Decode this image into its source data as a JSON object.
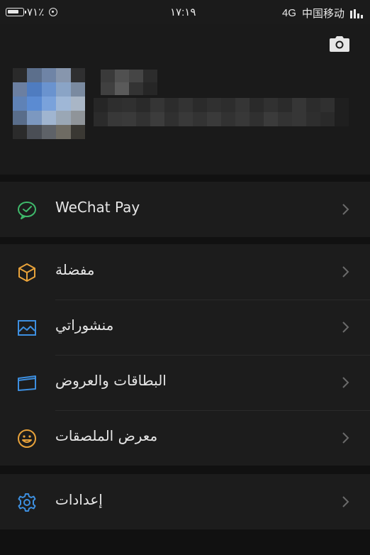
{
  "status_bar": {
    "battery_text": "٧١٪",
    "time": "١٧:١٩",
    "network": "4G",
    "carrier": "中国移动"
  },
  "menu": {
    "pay": {
      "label": "WeChat Pay",
      "icon": "wechat-pay-icon",
      "color": "#3fb96b"
    },
    "favorites": {
      "label": "مفضلة",
      "icon": "cube-icon",
      "color": "#e8a23a"
    },
    "posts": {
      "label": "منشوراتي",
      "icon": "image-icon",
      "color": "#3d8fe0"
    },
    "cards": {
      "label": "البطاقات والعروض",
      "icon": "card-icon",
      "color": "#3d8fe0"
    },
    "stickers": {
      "label": "معرض الملصقات",
      "icon": "smiley-icon",
      "color": "#e8a23a"
    },
    "settings": {
      "label": "إعدادات",
      "icon": "gear-icon",
      "color": "#3d8fe0"
    }
  }
}
